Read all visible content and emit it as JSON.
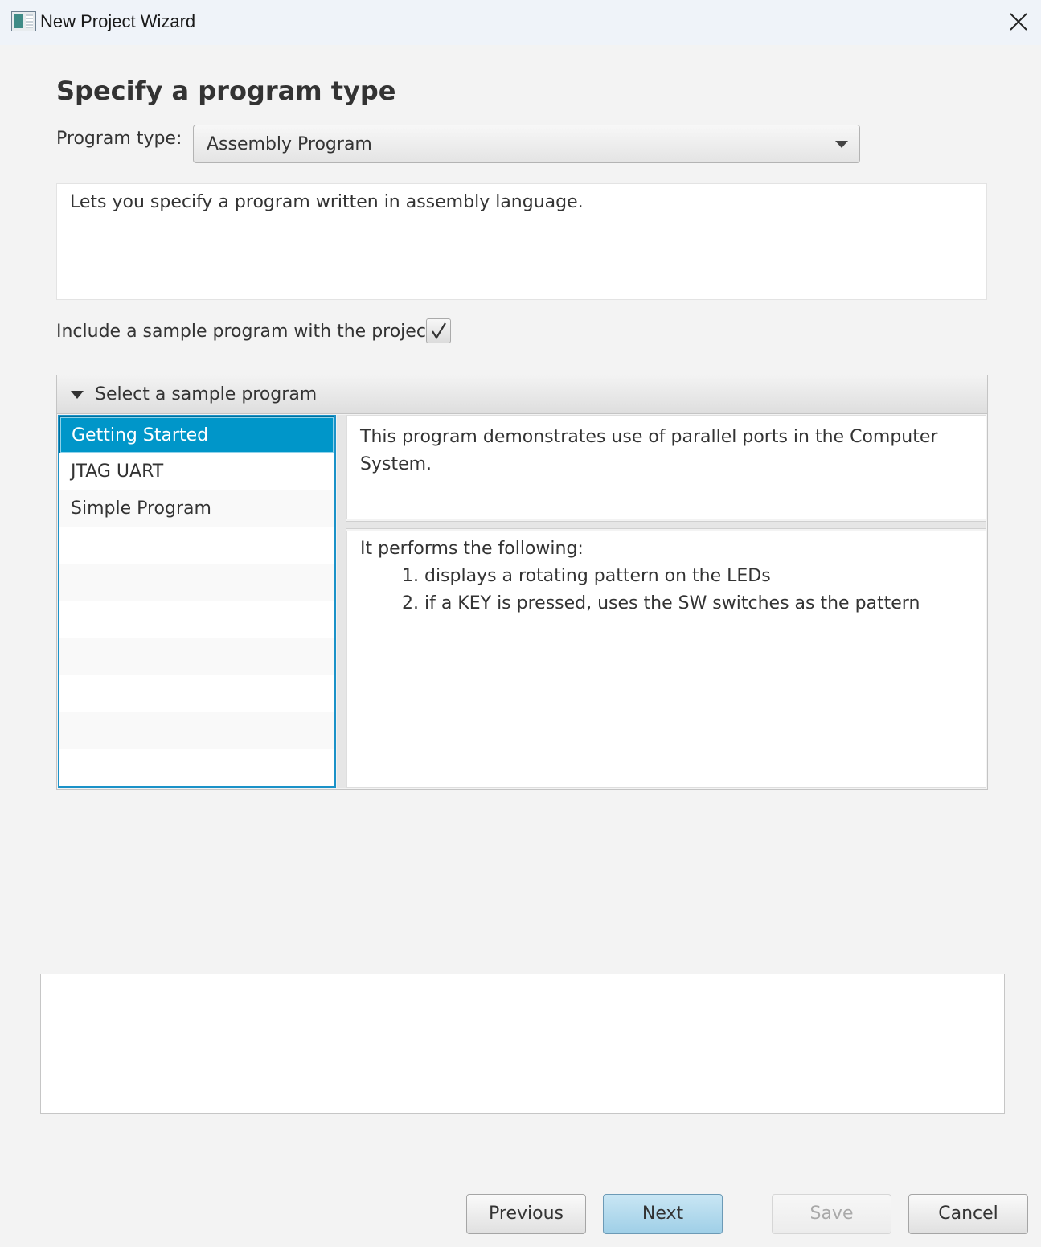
{
  "window": {
    "title": "New Project Wizard",
    "icon": "app-window-icon",
    "close_icon": "close-icon"
  },
  "page": {
    "heading": "Specify a program type"
  },
  "program_type": {
    "label": "Program type:",
    "selected": "Assembly Program",
    "description": "Lets you specify a program written in assembly language."
  },
  "sample_option": {
    "label": "Include a sample program with the project",
    "checked": true
  },
  "sample_pane": {
    "title": "Select a sample program",
    "expanded": true,
    "items": [
      {
        "label": "Getting Started",
        "selected": true
      },
      {
        "label": "JTAG UART",
        "selected": false
      },
      {
        "label": "Simple Program",
        "selected": false
      }
    ],
    "summary": "This program demonstrates use of parallel ports in the Computer System.",
    "details": {
      "intro": "It performs the following:",
      "steps": [
        "1. displays a rotating pattern on the LEDs",
        "2. if a KEY is pressed, uses the SW switches as the pattern"
      ]
    }
  },
  "message": "",
  "buttons": {
    "previous": "Previous",
    "next": "Next",
    "save": "Save",
    "cancel": "Cancel"
  },
  "colors": {
    "selection": "#0096c9",
    "focus_border": "#1b92c8",
    "default_button": "#a9d6ec"
  }
}
